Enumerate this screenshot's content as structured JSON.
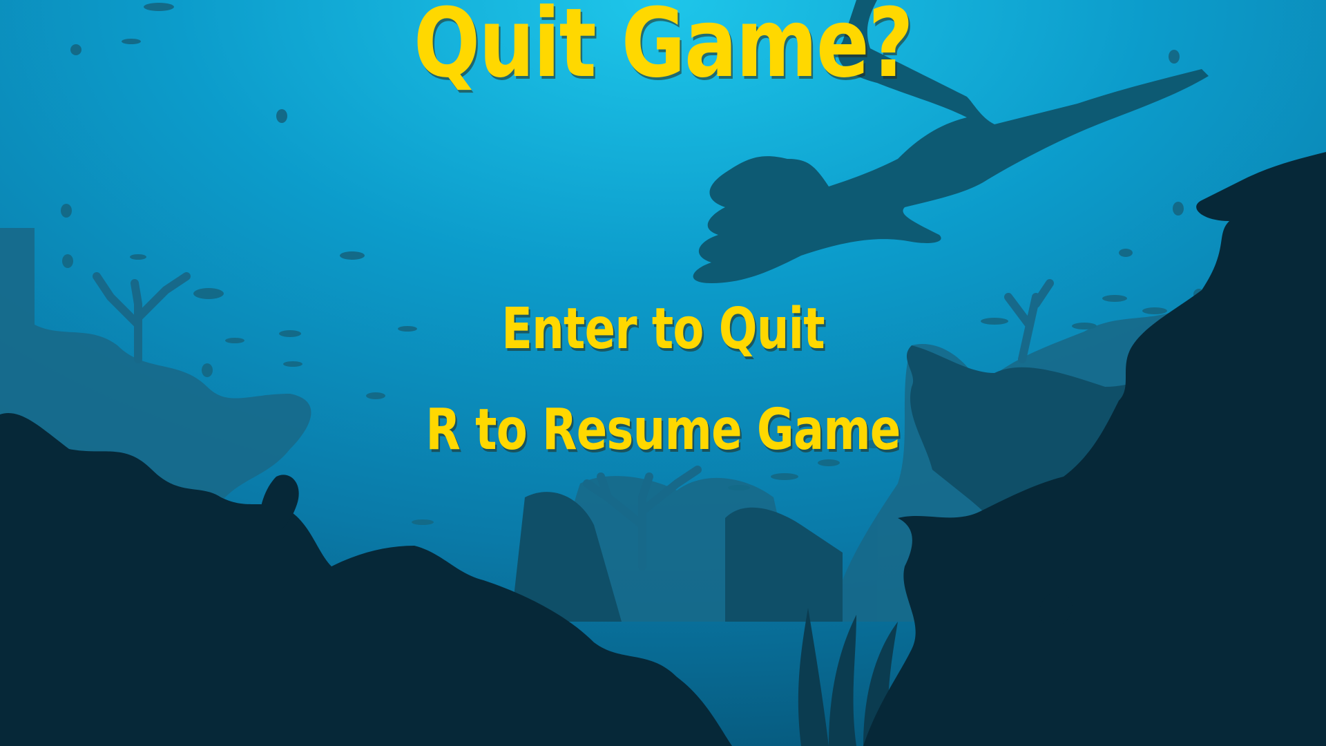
{
  "screen": {
    "title": "Quit Game?",
    "options": [
      {
        "key": "Enter",
        "label": "Enter to Quit"
      },
      {
        "key": "R",
        "label": "R to Resume Game"
      }
    ]
  },
  "colors": {
    "text": "#ffd800",
    "water_top": "#1ec3e6",
    "water_mid": "#0c86b6",
    "water_deep": "#065b80",
    "silhouette_far": "#1d6f8e",
    "silhouette_mid": "#0f4f68",
    "silhouette_near": "#062838"
  },
  "icons": [
    "diver-silhouette",
    "fish-icon",
    "coral-icon",
    "seaweed-icon"
  ]
}
